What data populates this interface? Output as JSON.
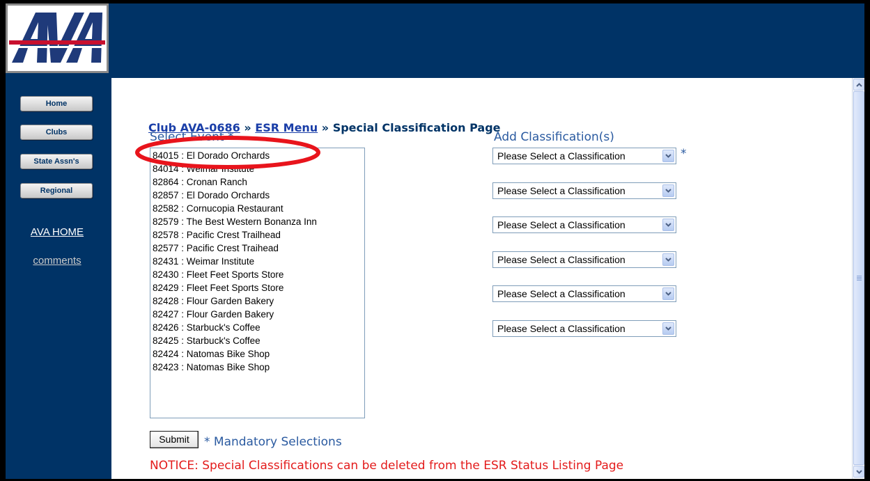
{
  "logo": {
    "alt": "AVA"
  },
  "sidebar": {
    "buttons": [
      {
        "label": "Home"
      },
      {
        "label": "Clubs"
      },
      {
        "label": "State Assn's"
      },
      {
        "label": "Regional"
      }
    ],
    "links": [
      {
        "label": "AVA HOME"
      },
      {
        "label": "comments"
      }
    ]
  },
  "breadcrumb": {
    "club": "Club AVA-0686",
    "separator": "»",
    "menu": "ESR Menu",
    "current": "Special Classification Page"
  },
  "select_event": {
    "heading": "Select Event *",
    "options": [
      "84015 : El Dorado Orchards",
      "84014 : Weimar Institute",
      "82864 : Cronan Ranch",
      "82857 : El Dorado Orchards",
      "82582 : Cornucopia Restaurant",
      "82579 : The Best Western Bonanza Inn",
      "82578 : Pacific Crest Trailhead",
      "82577 : Pacific Crest Traihead",
      "82431 : Weimar Institute",
      "82430 : Fleet Feet Sports Store",
      "82429 : Fleet Feet Sports Store",
      "82428 : Flour Garden Bakery",
      "82427 : Flour Garden Bakery",
      "82426 : Starbuck's Coffee",
      "82425 : Starbuck's Coffee",
      "82424 : Natomas Bike Shop",
      "82423 : Natomas Bike Shop"
    ]
  },
  "classification": {
    "heading": "Add Classification(s)",
    "required_marker": "*",
    "selects": [
      "Please Select a Classification",
      "Please Select a Classification",
      "Please Select a Classification",
      "Please Select a Classification",
      "Please Select a Classification",
      "Please Select a Classification"
    ]
  },
  "form": {
    "submit_label": "Submit",
    "mandatory_note": "* Mandatory Selections",
    "notice": "NOTICE: Special Classifications can be deleted from the ESR Status Listing Page"
  },
  "colors": {
    "frame": "#003366",
    "link": "#1a3ea8",
    "heading": "#2a5aa0",
    "notice": "#e31b1b",
    "annotation": "#e8141c"
  }
}
